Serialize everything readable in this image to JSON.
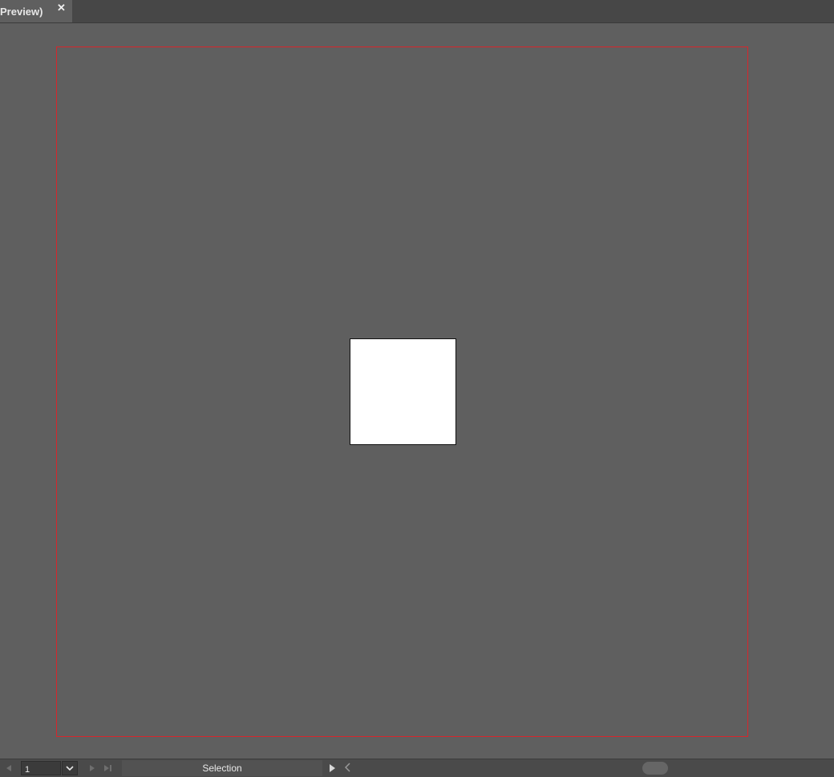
{
  "tab": {
    "title": "Preview)",
    "close_icon": "close-icon"
  },
  "status_bar": {
    "page_number": "1",
    "status_label": "Selection",
    "icons": [
      "first-page-icon",
      "chevron-down-icon",
      "next-page-icon",
      "last-page-icon",
      "play-icon",
      "chevron-left-icon"
    ]
  },
  "colors": {
    "canvas_background": "#5f5f5f",
    "artboard_border": "#d6262c",
    "rectangle_fill": "#ffffff"
  }
}
